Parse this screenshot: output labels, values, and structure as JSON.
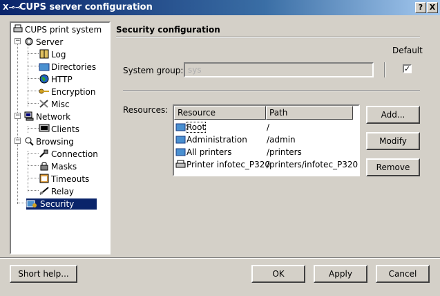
{
  "window": {
    "title": "CUPS server configuration",
    "help_btn": "?",
    "close_btn": "X"
  },
  "tree": {
    "root": "CUPS print system",
    "server": "Server",
    "log": "Log",
    "directories": "Directories",
    "http": "HTTP",
    "encryption": "Encryption",
    "misc": "Misc",
    "network": "Network",
    "clients": "Clients",
    "browsing": "Browsing",
    "connection": "Connection",
    "masks": "Masks",
    "timeouts": "Timeouts",
    "relay": "Relay",
    "security": "Security"
  },
  "security": {
    "title": "Security configuration",
    "default_label": "Default",
    "system_group_label": "System group:",
    "system_group_value": "sys",
    "default_checked": "✓",
    "resources_label": "Resources:",
    "columns": {
      "resource": "Resource",
      "path": "Path"
    },
    "rows": [
      {
        "resource": "Root",
        "path": "/"
      },
      {
        "resource": "Administration",
        "path": "/admin"
      },
      {
        "resource": "All printers",
        "path": "/printers"
      },
      {
        "resource": "Printer infotec_P320",
        "path": "/printers/infotec_P320"
      }
    ],
    "add_btn": "Add...",
    "modify_btn": "Modify",
    "remove_btn": "Remove"
  },
  "footer": {
    "short_help": "Short help...",
    "ok": "OK",
    "apply": "Apply",
    "cancel": "Cancel"
  },
  "colors": {
    "title_bar": "#0a246a",
    "selection": "#0a246a",
    "face": "#d4d0c8"
  }
}
